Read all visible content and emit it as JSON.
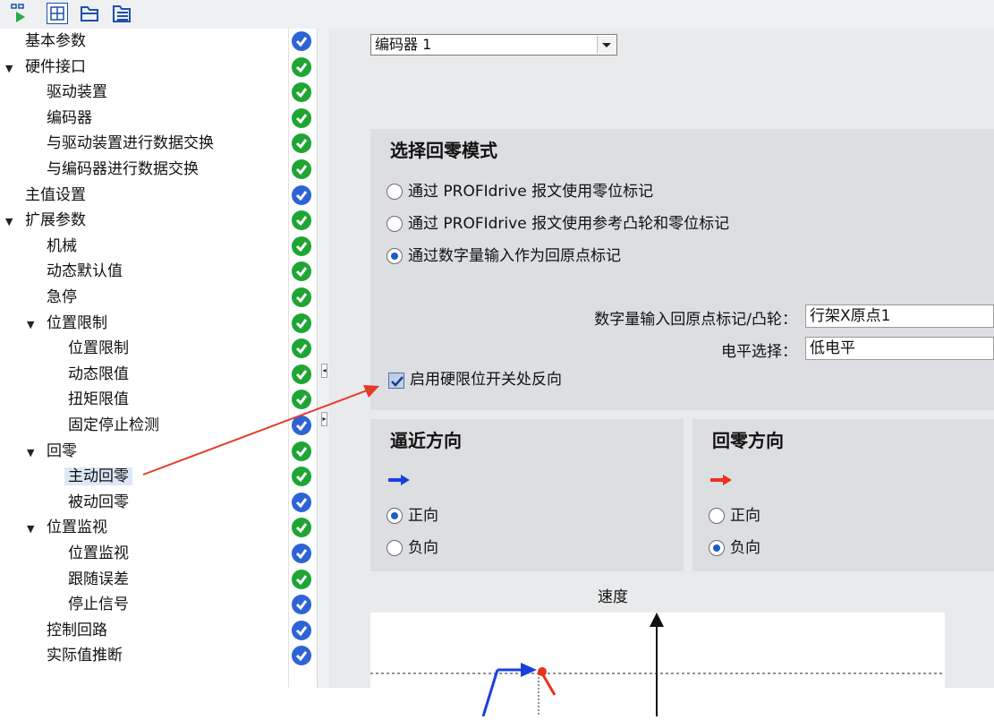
{
  "toolbar": {
    "icons": [
      "view-toggle-icon",
      "expand-all-icon",
      "folder-icon",
      "folder-list-icon"
    ]
  },
  "tree": {
    "items": [
      {
        "label": "基本参数",
        "status": "blue",
        "level": 0
      },
      {
        "label": "硬件接口",
        "status": "green",
        "level": 0,
        "expanded": true
      },
      {
        "label": "驱动装置",
        "status": "green",
        "level": 1
      },
      {
        "label": "编码器",
        "status": "green",
        "level": 1
      },
      {
        "label": "与驱动装置进行数据交换",
        "status": "green",
        "level": 1
      },
      {
        "label": "与编码器进行数据交换",
        "status": "green",
        "level": 1
      },
      {
        "label": "主值设置",
        "status": "blue",
        "level": 0
      },
      {
        "label": "扩展参数",
        "status": "green",
        "level": 0,
        "expanded": true
      },
      {
        "label": "机械",
        "status": "green",
        "level": 1
      },
      {
        "label": "动态默认值",
        "status": "green",
        "level": 1
      },
      {
        "label": "急停",
        "status": "green",
        "level": 1
      },
      {
        "label": "位置限制",
        "status": "green",
        "level": 1,
        "expanded": true
      },
      {
        "label": "位置限制",
        "status": "green",
        "level": 2
      },
      {
        "label": "动态限值",
        "status": "green",
        "level": 2
      },
      {
        "label": "扭矩限值",
        "status": "green",
        "level": 2
      },
      {
        "label": "固定停止检测",
        "status": "blue",
        "level": 2
      },
      {
        "label": "回零",
        "status": "green",
        "level": 1,
        "expanded": true
      },
      {
        "label": "主动回零",
        "status": "green",
        "level": 2,
        "selected": true
      },
      {
        "label": "被动回零",
        "status": "blue",
        "level": 2
      },
      {
        "label": "位置监视",
        "status": "green",
        "level": 1,
        "expanded": true
      },
      {
        "label": "位置监视",
        "status": "blue",
        "level": 2
      },
      {
        "label": "跟随误差",
        "status": "green",
        "level": 2
      },
      {
        "label": "停止信号",
        "status": "blue",
        "level": 2
      },
      {
        "label": "控制回路",
        "status": "blue",
        "level": 1
      },
      {
        "label": "实际值推断",
        "status": "blue",
        "level": 1
      }
    ]
  },
  "encoder_select": {
    "value": "编码器 1"
  },
  "homing_mode": {
    "title": "选择回零模式",
    "options": [
      {
        "label": "通过 PROFIdrive 报文使用零位标记",
        "selected": false
      },
      {
        "label": "通过 PROFIdrive 报文使用参考凸轮和零位标记",
        "selected": false
      },
      {
        "label": "通过数字量输入作为回原点标记",
        "selected": true
      }
    ],
    "digital_input_label": "数字量输入回原点标记/凸轮：",
    "digital_input_value": "行架X原点1",
    "level_label": "电平选择：",
    "level_value": "低电平",
    "reverse_checkbox_label": "启用硬限位开关处反向",
    "reverse_checked": true
  },
  "approach_direction": {
    "title": "逼近方向",
    "arrow_color": "#1a3fe0",
    "options": [
      {
        "label": "正向",
        "selected": true
      },
      {
        "label": "负向",
        "selected": false
      }
    ]
  },
  "homing_direction": {
    "title": "回零方向",
    "arrow_color": "#e8321c",
    "options": [
      {
        "label": "正向",
        "selected": false
      },
      {
        "label": "负向",
        "selected": true
      }
    ]
  },
  "plot": {
    "label": "速度"
  },
  "colors": {
    "status_green": "#1fa534",
    "status_blue": "#2d63d6",
    "annotation_arrow": "#e53a2a"
  }
}
